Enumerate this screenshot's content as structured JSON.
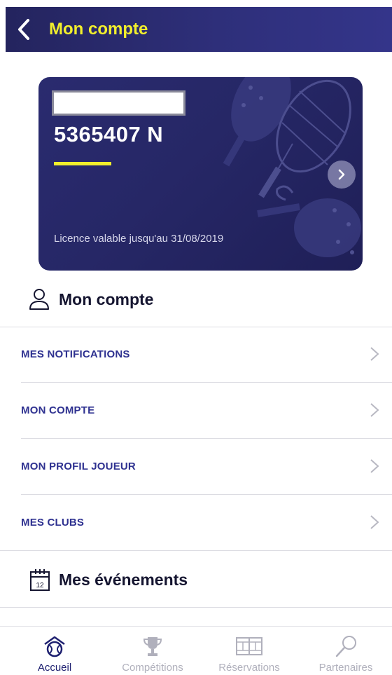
{
  "header": {
    "title": "Mon compte"
  },
  "card": {
    "license_number": "5365407 N",
    "validity": "Licence valable jusqu'au 31/08/2019"
  },
  "account_section": {
    "title": "Mon compte",
    "items": [
      {
        "label": "MES NOTIFICATIONS"
      },
      {
        "label": "MON COMPTE"
      },
      {
        "label": "MON PROFIL JOUEUR"
      },
      {
        "label": "MES CLUBS"
      }
    ]
  },
  "events_section": {
    "title": "Mes événements",
    "calendar_day": "12"
  },
  "tabbar": {
    "tabs": [
      {
        "label": "Accueil",
        "active": true
      },
      {
        "label": "Compétitions",
        "active": false
      },
      {
        "label": "Réservations",
        "active": false
      },
      {
        "label": "Partenaires",
        "active": false
      }
    ]
  },
  "colors": {
    "primary": "#2e3190",
    "accent": "#f2ef2c",
    "header_bg": "#2a2b6f"
  }
}
